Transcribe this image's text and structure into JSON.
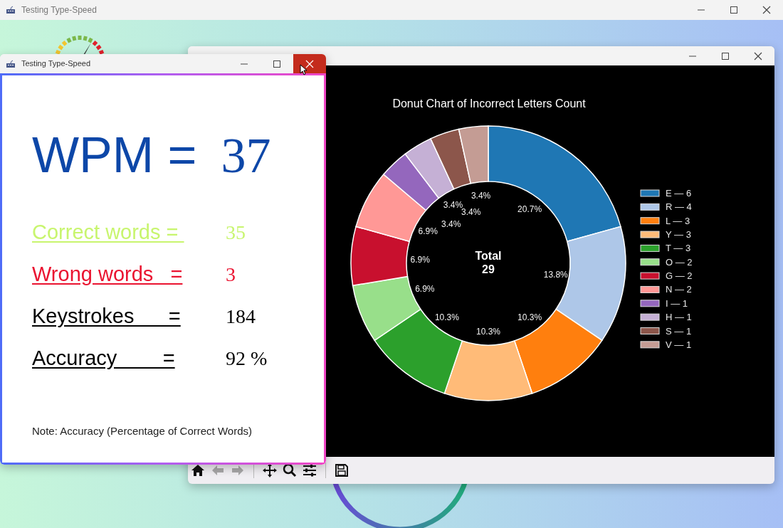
{
  "main_window": {
    "title": "Testing Type-Speed"
  },
  "results_window": {
    "title": "Testing Type-Speed",
    "close_hovered": true,
    "wpm": {
      "label": "WPM =",
      "value": "37"
    },
    "stats": [
      {
        "label": "Correct words = ",
        "value": "35",
        "color": "#c8f56e"
      },
      {
        "label": "Wrong words   =",
        "value": "3",
        "color": "#ea1330"
      },
      {
        "label": "Keystrokes      =",
        "value": "184",
        "color": "#000000"
      },
      {
        "label": "Accuracy        =",
        "value": "92 %",
        "color": "#000000"
      }
    ],
    "note": "Note: Accuracy (Percentage of Correct Words)"
  },
  "figure_window": {
    "chart_data": {
      "type": "donut",
      "title": "Donut Chart of Incorrect Letters Count",
      "categories": [
        "E — 6",
        "R — 4",
        "L — 3",
        "Y — 3",
        "T — 3",
        "O — 2",
        "G — 2",
        "N — 2",
        "I — 1",
        "H — 1",
        "S — 1",
        "V — 1"
      ],
      "series": [
        {
          "values": [
            6,
            4,
            3,
            3,
            3,
            2,
            2,
            2,
            1,
            1,
            1,
            1
          ]
        }
      ],
      "legend": true,
      "colors": [
        "#1f77b4",
        "#aec7e8",
        "#ff7f0e",
        "#ffbb78",
        "#2ca02c",
        "#98df8a",
        "#c8102e",
        "#ff9896",
        "#9467bd",
        "#c5b0d5",
        "#8c564b",
        "#c49c94"
      ],
      "value_labels": [
        "20.7%",
        "13.8%",
        "10.3%",
        "10.3%",
        "10.3%",
        "6.9%",
        "6.9%",
        "6.9%",
        "3.4%",
        "3.4%",
        "3.4%",
        "3.4%"
      ],
      "annotations": [
        "Total",
        "29"
      ]
    },
    "toolbar": [
      {
        "kind": "home",
        "disabled": false
      },
      {
        "kind": "back",
        "disabled": true
      },
      {
        "kind": "forward",
        "disabled": true
      },
      {
        "kind": "sep"
      },
      {
        "kind": "pan",
        "disabled": false
      },
      {
        "kind": "zoom",
        "disabled": false
      },
      {
        "kind": "configure",
        "disabled": false
      },
      {
        "kind": "sep"
      },
      {
        "kind": "save",
        "disabled": false
      }
    ]
  }
}
